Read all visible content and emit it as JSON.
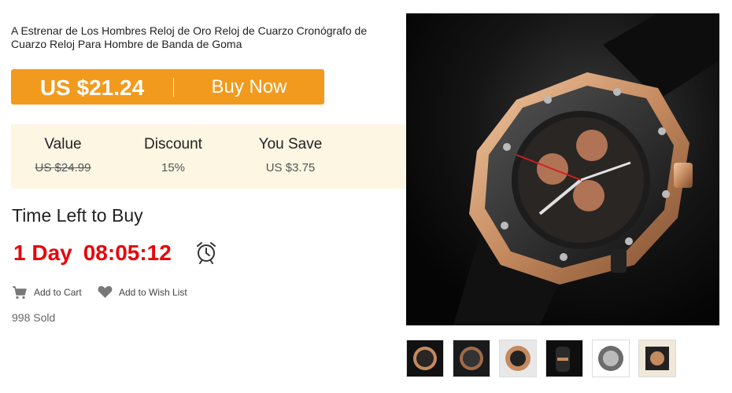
{
  "product": {
    "title": "A Estrenar de Los Hombres Reloj de Oro Reloj de Cuarzo Cronógrafo de Cuarzo Reloj Para Hombre de Banda de Goma"
  },
  "buy": {
    "price": "US $21.24",
    "button_label": "Buy Now"
  },
  "pricing": {
    "value_label": "Value",
    "value_amount": "US $24.99",
    "discount_label": "Discount",
    "discount_amount": "15%",
    "save_label": "You Save",
    "save_amount": "US $3.75"
  },
  "timer": {
    "title": "Time Left to Buy",
    "days": "1 Day",
    "time": "08:05:12"
  },
  "actions": {
    "add_to_cart": "Add to Cart",
    "add_to_wishlist": "Add to Wish List"
  },
  "sold": "998 Sold",
  "colors": {
    "buy_bar": "#f29a1d",
    "countdown": "#e8060c",
    "panel": "#fdf6e3"
  },
  "icons": [
    "cart-icon",
    "heart-icon",
    "alarm-clock-icon"
  ]
}
